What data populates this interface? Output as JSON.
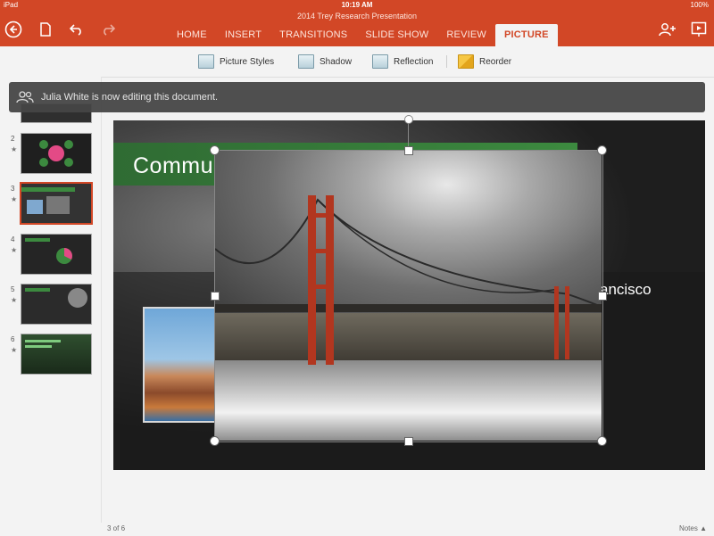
{
  "status": {
    "device": "iPad",
    "time": "10:19 AM",
    "battery": "100%"
  },
  "document": {
    "title": "2014 Trey Research Presentation"
  },
  "tabs": [
    {
      "label": "HOME"
    },
    {
      "label": "INSERT"
    },
    {
      "label": "TRANSITIONS"
    },
    {
      "label": "SLIDE SHOW"
    },
    {
      "label": "REVIEW"
    },
    {
      "label": "PICTURE",
      "active": true
    }
  ],
  "ribbon": {
    "picture_styles": "Picture Styles",
    "shadow": "Shadow",
    "reflection": "Reflection",
    "reorder": "Reorder"
  },
  "notification": {
    "text": "Julia White is now editing this document."
  },
  "thumbnails": [
    {
      "number": "2"
    },
    {
      "number": "3"
    },
    {
      "number": "4"
    },
    {
      "number": "5"
    },
    {
      "number": "6"
    }
  ],
  "slide": {
    "title": "Commu",
    "city_label": "ancisco"
  },
  "footer": {
    "page_count": "3 of 6",
    "notes": "Notes"
  },
  "colors": {
    "accent": "#d24726",
    "title_band": "#3c8a3f"
  }
}
